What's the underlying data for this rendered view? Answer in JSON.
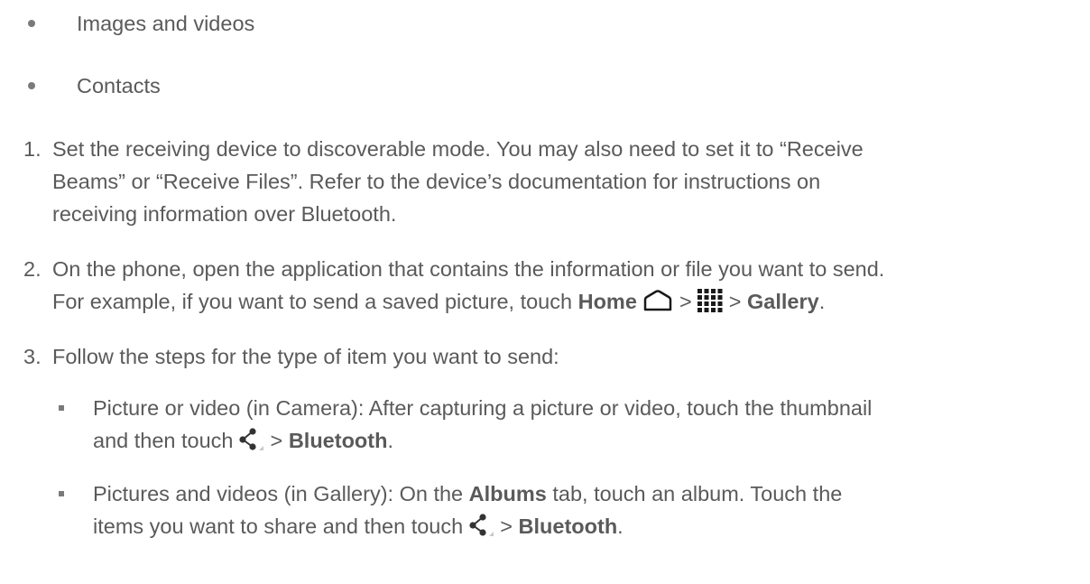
{
  "bullets": [
    {
      "text": "Images and videos"
    },
    {
      "text": "Contacts"
    }
  ],
  "steps": [
    {
      "number": "1.",
      "lines": [
        "Set the receiving device to discoverable mode. You may also need to set it to “Receive",
        "Beams” or “Receive Files”. Refer to the device’s documentation for instructions on",
        "receiving information over Bluetooth."
      ]
    },
    {
      "number": "2.",
      "line1": "On the phone, open the application that contains the information or file you want to send.",
      "line2_pre": "For example, if you want to send a saved picture, touch ",
      "home": "Home",
      "sep1": " > ",
      "sep2": " > ",
      "gallery": "Gallery",
      "period": "."
    },
    {
      "number": "3.",
      "text": "Follow the steps for the type of item you want to send:"
    }
  ],
  "subitems": [
    {
      "line1": "Picture or video (in Camera): After capturing a picture or video, touch the thumbnail",
      "line2_pre": "and then touch ",
      "sep": " > ",
      "target": "Bluetooth",
      "period": "."
    },
    {
      "line1_pre": "Pictures and videos (in Gallery): On the ",
      "albums": "Albums",
      "line1_post": " tab, touch an album. Touch the",
      "line2_pre": "items you want to share and then touch ",
      "sep": " > ",
      "target": "Bluetooth",
      "period": "."
    }
  ],
  "icons": [
    "home-icon",
    "apps-grid-icon",
    "share-icon"
  ],
  "colors": {
    "text": "#5a5a5a",
    "bullet": "#7a7a7a",
    "icon": "#1a1a1a"
  }
}
